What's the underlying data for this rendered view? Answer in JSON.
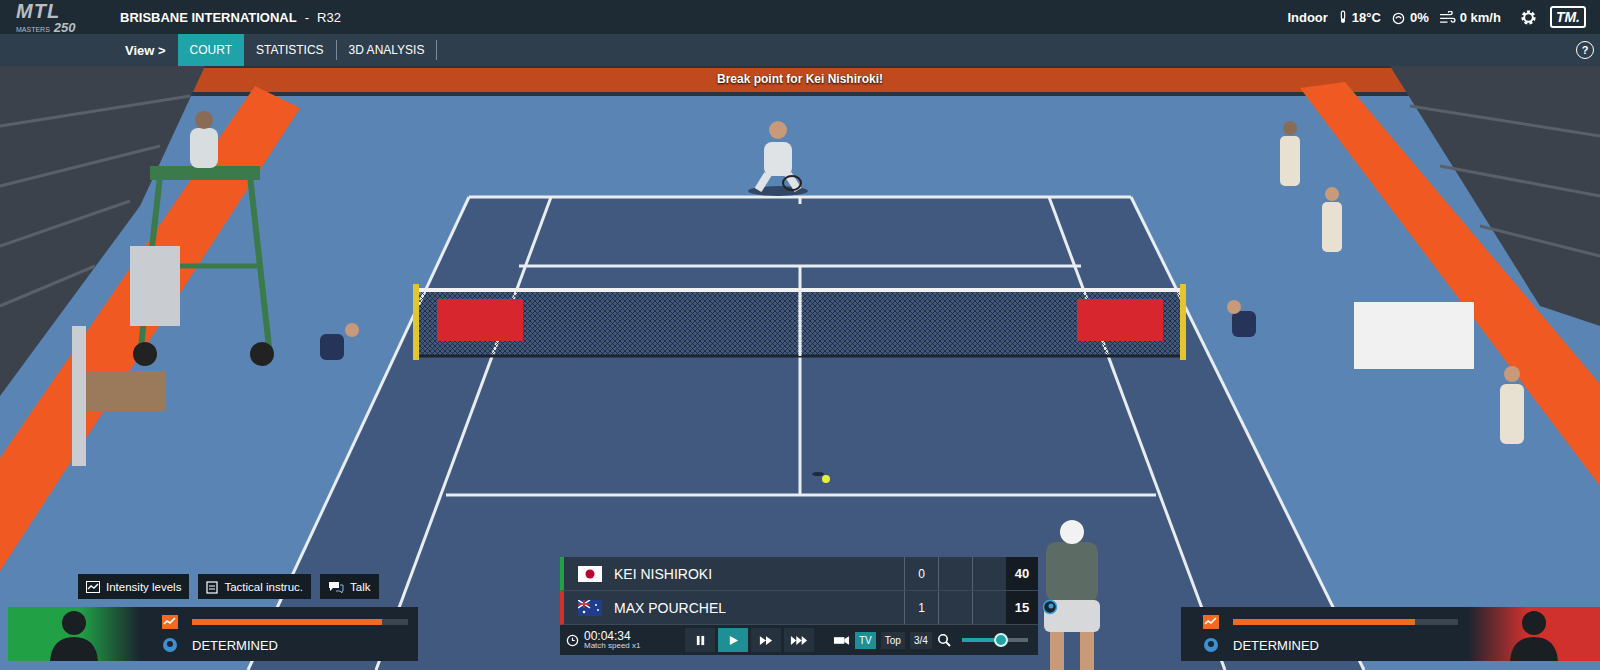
{
  "topbar": {
    "logo": {
      "main": "MTL",
      "sub": "MASTERS",
      "number": "250"
    },
    "tournament": "BRISBANE INTERNATIONAL",
    "separator": "-",
    "round": "R32",
    "conditions": [
      {
        "kind": "venue",
        "text": "Indoor"
      },
      {
        "kind": "temperature",
        "text": "18°C"
      },
      {
        "kind": "humidity",
        "text": "0%"
      },
      {
        "kind": "wind",
        "text": "0 km/h"
      }
    ],
    "brand": "TM."
  },
  "viewbar": {
    "label": "View >",
    "tabs": [
      {
        "label": "COURT",
        "selected": true
      },
      {
        "label": "STATISTICS",
        "selected": false
      },
      {
        "label": "3D ANALYSIS",
        "selected": false
      }
    ],
    "help": "?"
  },
  "announcement": "Break point for Kei Nishiroki!",
  "actions": [
    {
      "kind": "intensity",
      "label": "Intensity levels"
    },
    {
      "kind": "tactics",
      "label": "Tactical instruc."
    },
    {
      "kind": "talk",
      "label": "Talk"
    }
  ],
  "players": [
    {
      "name": "KEI NISHIROKI",
      "kind": "japan",
      "color": "#22a046",
      "sets": "0",
      "points": "40",
      "serving": false,
      "mood": "DETERMINED",
      "intensity": 0.88
    },
    {
      "name": "MAX POURCHEL",
      "kind": "australia",
      "color": "#d0312d",
      "sets": "1",
      "points": "15",
      "serving": true,
      "mood": "DETERMINED",
      "intensity": 0.81
    }
  ],
  "controls": {
    "time": "00:04:34",
    "speed": "Match speed x1",
    "buttons": [
      {
        "kind": "pause",
        "selected": false
      },
      {
        "kind": "play",
        "selected": true
      },
      {
        "kind": "fast",
        "selected": false
      },
      {
        "kind": "fastest",
        "selected": false
      }
    ],
    "cameras": [
      {
        "label": "TV",
        "selected": true
      },
      {
        "label": "Top",
        "selected": false
      },
      {
        "label": "3/4",
        "selected": false
      }
    ],
    "zoom": {
      "level": 0.6
    }
  }
}
